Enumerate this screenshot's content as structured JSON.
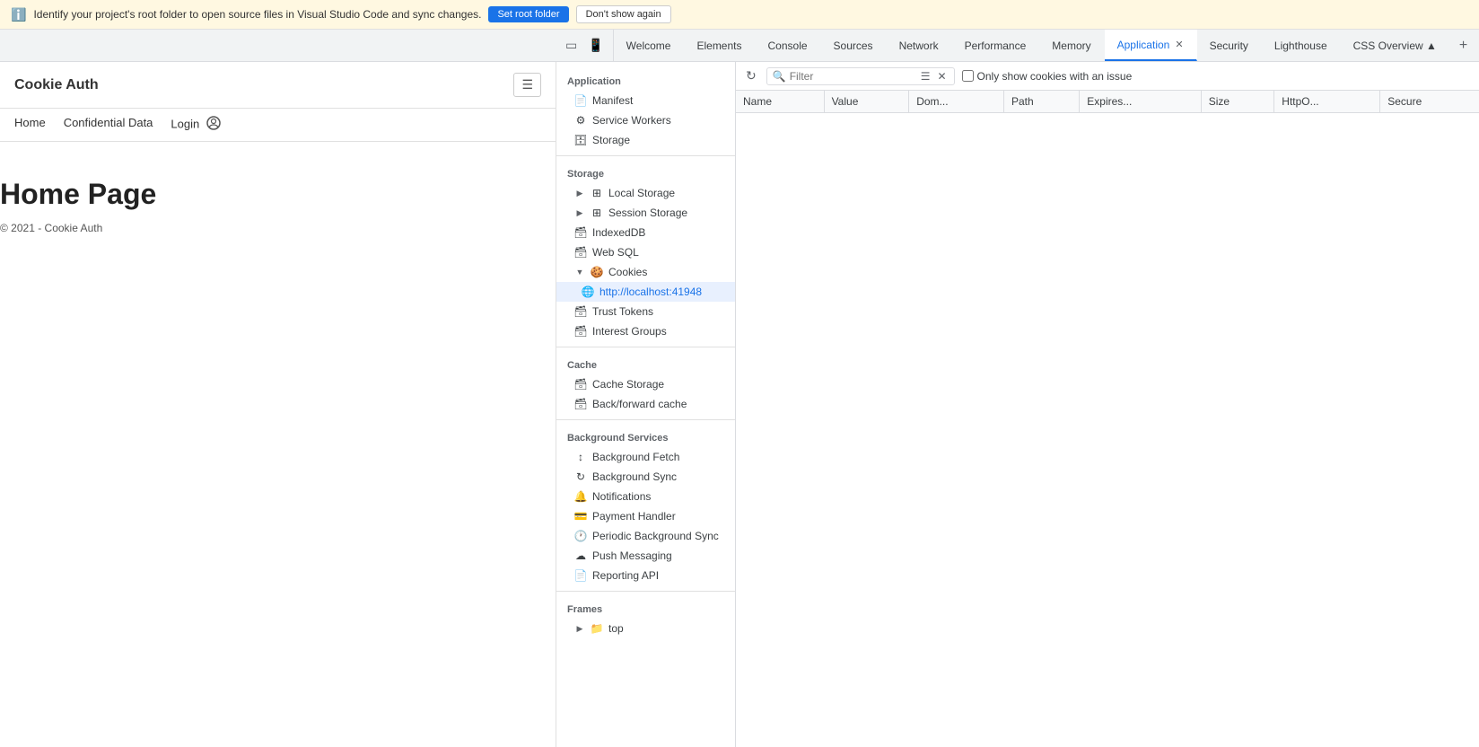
{
  "infoBar": {
    "message": "Identify your project's root folder to open source files in Visual Studio Code and sync changes.",
    "setRootLabel": "Set root folder",
    "dontShowLabel": "Don't show again"
  },
  "devtoolsTabs": {
    "icons": [
      "☰",
      "⇄"
    ],
    "tabs": [
      {
        "id": "welcome",
        "label": "Welcome",
        "active": false
      },
      {
        "id": "elements",
        "label": "Elements",
        "active": false
      },
      {
        "id": "console",
        "label": "Console",
        "active": false
      },
      {
        "id": "sources",
        "label": "Sources",
        "active": false
      },
      {
        "id": "network",
        "label": "Network",
        "active": false
      },
      {
        "id": "performance",
        "label": "Performance",
        "active": false
      },
      {
        "id": "memory",
        "label": "Memory",
        "active": false
      },
      {
        "id": "application",
        "label": "Application",
        "active": true,
        "closeable": true
      },
      {
        "id": "security",
        "label": "Security",
        "active": false
      },
      {
        "id": "lighthouse",
        "label": "Lighthouse",
        "active": false
      },
      {
        "id": "css-overview",
        "label": "CSS Overview ▲",
        "active": false
      }
    ]
  },
  "appPage": {
    "title": "Cookie Auth",
    "navLinks": [
      "Home",
      "Confidential Data",
      "Login"
    ],
    "pageTitle": "Home Page",
    "copyright": "© 2021 - Cookie Auth"
  },
  "sidebar": {
    "applicationSection": "Application",
    "applicationItems": [
      {
        "id": "manifest",
        "label": "Manifest",
        "icon": "📄",
        "indent": 1
      },
      {
        "id": "service-workers",
        "label": "Service Workers",
        "icon": "⚙️",
        "indent": 1
      },
      {
        "id": "storage",
        "label": "Storage",
        "icon": "🗄️",
        "indent": 1
      }
    ],
    "storageSection": "Storage",
    "storageItems": [
      {
        "id": "local-storage",
        "label": "Local Storage",
        "icon": "⊞",
        "indent": 1,
        "expandable": true,
        "expanded": false
      },
      {
        "id": "session-storage",
        "label": "Session Storage",
        "icon": "⊞",
        "indent": 1,
        "expandable": true,
        "expanded": false
      },
      {
        "id": "indexeddb",
        "label": "IndexedDB",
        "icon": "🗃️",
        "indent": 1
      },
      {
        "id": "web-sql",
        "label": "Web SQL",
        "icon": "🗃️",
        "indent": 1
      },
      {
        "id": "cookies",
        "label": "Cookies",
        "icon": "🍪",
        "indent": 1,
        "expandable": true,
        "expanded": true
      },
      {
        "id": "cookies-localhost",
        "label": "http://localhost:41948",
        "icon": "🌐",
        "indent": 2,
        "active": true
      },
      {
        "id": "trust-tokens",
        "label": "Trust Tokens",
        "icon": "🗃️",
        "indent": 1
      },
      {
        "id": "interest-groups",
        "label": "Interest Groups",
        "icon": "🗃️",
        "indent": 1
      }
    ],
    "cacheSection": "Cache",
    "cacheItems": [
      {
        "id": "cache-storage",
        "label": "Cache Storage",
        "icon": "🗃️",
        "indent": 1
      },
      {
        "id": "back-forward-cache",
        "label": "Back/forward cache",
        "icon": "🗃️",
        "indent": 1
      }
    ],
    "backgroundSection": "Background Services",
    "backgroundItems": [
      {
        "id": "background-fetch",
        "label": "Background Fetch",
        "icon": "↕",
        "indent": 1
      },
      {
        "id": "background-sync",
        "label": "Background Sync",
        "icon": "↻",
        "indent": 1
      },
      {
        "id": "notifications",
        "label": "Notifications",
        "icon": "🔔",
        "indent": 1
      },
      {
        "id": "payment-handler",
        "label": "Payment Handler",
        "icon": "💳",
        "indent": 1
      },
      {
        "id": "periodic-background-sync",
        "label": "Periodic Background Sync",
        "icon": "🕐",
        "indent": 1
      },
      {
        "id": "push-messaging",
        "label": "Push Messaging",
        "icon": "☁",
        "indent": 1
      },
      {
        "id": "reporting-api",
        "label": "Reporting API",
        "icon": "📄",
        "indent": 1
      }
    ],
    "framesSection": "Frames",
    "framesItems": [
      {
        "id": "top-frame",
        "label": "top",
        "icon": "📁",
        "indent": 1,
        "expandable": true
      }
    ]
  },
  "cookiesPanel": {
    "filterPlaceholder": "Filter",
    "filterValue": "",
    "onlyIssueLabel": "Only show cookies with an issue",
    "columns": [
      "Name",
      "Value",
      "Dom...",
      "Path",
      "Expires...",
      "Size",
      "HttpO...",
      "Secure"
    ],
    "rows": []
  }
}
